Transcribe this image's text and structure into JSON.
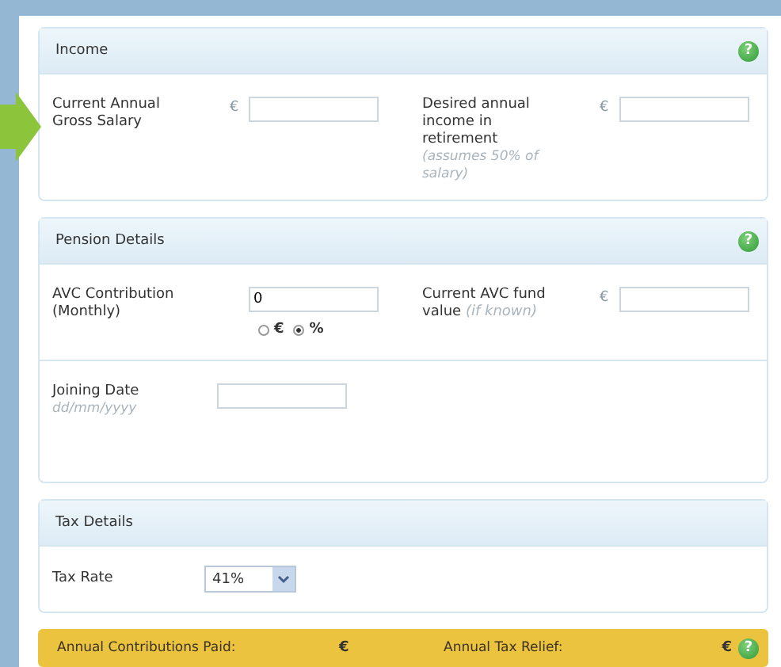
{
  "income": {
    "title": "Income",
    "help": "?",
    "fields": [
      {
        "label": "Current Annual Gross Salary",
        "currency": "€"
      },
      {
        "label": "Desired annual income in retirement",
        "note": "(assumes 50% of salary)",
        "currency": "€"
      }
    ]
  },
  "pension": {
    "title": "Pension Details",
    "help": "?",
    "contribution": {
      "label": "AVC Contribution (Monthly)",
      "value": "0",
      "options": [
        {
          "label": "€",
          "selected": false
        },
        {
          "label": "%",
          "selected": true
        }
      ]
    },
    "fund": {
      "label": "Current AVC fund value",
      "note": "(if known)",
      "currency": "€"
    },
    "joining": {
      "label": "Joining Date",
      "note": "dd/mm/yyyy"
    }
  },
  "tax": {
    "title": "Tax Details",
    "rate_label": "Tax Rate",
    "rate_value": "41%"
  },
  "summary": {
    "contributions_label": "Annual Contributions Paid:",
    "contributions_currency": "€",
    "relief_label": "Annual Tax Relief:",
    "relief_currency": "€",
    "help": "?"
  }
}
